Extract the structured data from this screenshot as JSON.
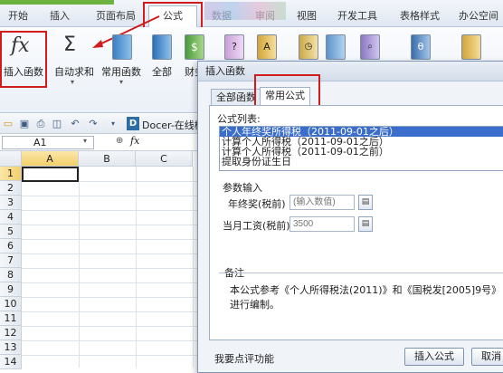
{
  "menu": {
    "tabs": [
      "开始",
      "插入",
      "页面布局",
      "公式",
      "数据",
      "审阅",
      "视图",
      "开发工具",
      "表格样式",
      "办公空间"
    ],
    "active_tab": "公式"
  },
  "ribbon": {
    "insert_function": "插入函数",
    "autosum": "自动求和",
    "common_functions": "常用函数",
    "all": "全部",
    "finance_partial": "财务"
  },
  "toolbar": {
    "docer_badge": "D",
    "docer_label": "Docer-在线模板"
  },
  "name_box": {
    "value": "A1",
    "fx_label": "fx"
  },
  "grid": {
    "columns": [
      "A",
      "B",
      "C"
    ],
    "rows": [
      "1",
      "2",
      "3",
      "4",
      "5",
      "6",
      "7",
      "8",
      "9",
      "10",
      "11",
      "12",
      "13",
      "14"
    ]
  },
  "dialog": {
    "title": "插入函数",
    "tabs": [
      "全部函数",
      "常用公式"
    ],
    "active_tab": "常用公式",
    "formula_list_label": "公式列表:",
    "formula_list": [
      "个人年终奖所得税（2011-09-01之后）",
      "计算个人所得税（2011-09-01之后）",
      "计算个人所得税（2011-09-01之前）",
      "提取身份证生日"
    ],
    "selected_index": 0,
    "params_label": "参数输入",
    "bonus_label": "年终奖(税前)",
    "bonus_placeholder": "(输入数值)",
    "salary_label": "当月工资(税前)",
    "salary_placeholder": "3500",
    "notes_label": "备注",
    "notes_text": "本公式参考《个人所得税法(2011)》和《国税发[2005]9号》进行编制。",
    "feedback_link": "我要点评功能",
    "insert_button": "插入公式",
    "cancel_button": "取消"
  },
  "colors": {
    "highlight_red": "#d01c1c",
    "selection_blue": "#3a6dcc"
  }
}
